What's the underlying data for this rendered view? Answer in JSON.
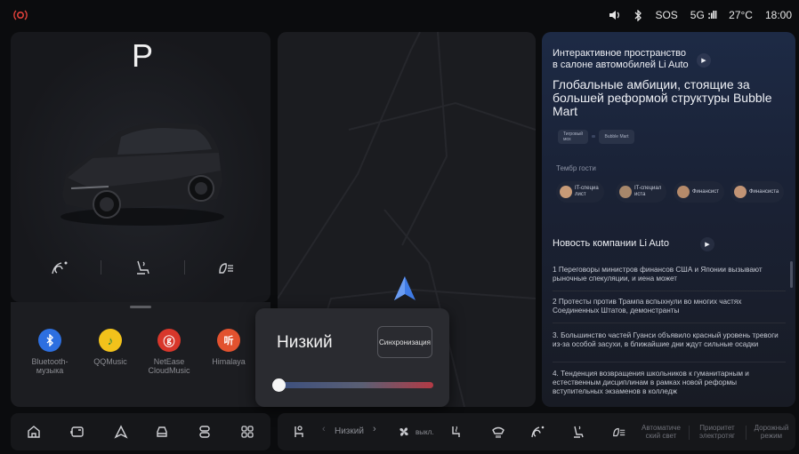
{
  "status_bar": {
    "icons": [
      "hazard-icon",
      "volume-icon",
      "bluetooth-icon"
    ],
    "sos": "SOS",
    "network": "5G",
    "signal_glyph": ":ıll",
    "temperature": "27°C",
    "time": "18:00"
  },
  "vehicle": {
    "gear": "P",
    "controls": [
      "steering-heat-icon",
      "seat-heat-icon",
      "headlight-icon"
    ]
  },
  "media_apps": [
    {
      "label": "Bluetooth-\nмузыка",
      "icon": "bluetooth-icon",
      "color": "#2d6fe0"
    },
    {
      "label": "QQMusic",
      "icon": "qqmusic-icon",
      "color": "#f2c21b"
    },
    {
      "label": "NetEase\nCloudMusic",
      "icon": "netease-icon",
      "color": "#d8372b"
    },
    {
      "label": "Himalaya",
      "icon": "himalaya-icon",
      "color": "#e2522f"
    }
  ],
  "climate_popup": {
    "level": "Низкий",
    "sync_label": "Синхронизация",
    "slider_value": 0.02
  },
  "info_panel": {
    "top_line": "Интерактивное пространство\nв салоне автомобилей Li Auto",
    "headline": "Глобальные амбиции, стоящие за\nбольшей реформой структуры Bubble Mart",
    "chips": [
      "Тигровый\nмох",
      "Bubble Mart"
    ],
    "guest_title": "Тембр гости",
    "guests": [
      "IT-специа\nлист",
      "IT-специал\nиста",
      "Финансист",
      "Финансиста"
    ],
    "news_title": "Новость компании Li Auto",
    "news": [
      "1 Переговоры министров финансов США и Японии вызывают рыночные спекуляции, и иена может",
      "2 Протесты против Трампа вспыхнули во многих частях Соединенных Штатов, демонстранты",
      "3. Большинство частей Гуанси объявило красный уровень тревоги из-за особой засухи, в ближайшие дни ждут сильные осадки",
      "4. Тенденция возвращения школьников к гуманитарным и естественным дисциплинам в рамках новой реформы вступительных экзаменов в колледж"
    ]
  },
  "bottom_bar": {
    "left_icons": [
      "home-icon",
      "car-side-icon",
      "navigation-icon",
      "car-front-icon",
      "settings-icon",
      "apps-grid-icon"
    ],
    "fan_level": "Низкий",
    "fan_prev": "‹",
    "fan_next": "›",
    "fan_off": "выкл.",
    "auto_light": "Автоматиче\nский свет",
    "priority": "Приоритет\nэлектротяг",
    "road_mode": "Дорожный\nрежим"
  }
}
